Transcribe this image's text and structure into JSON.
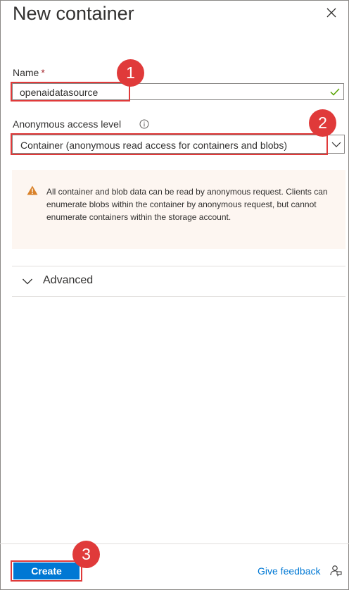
{
  "panel": {
    "title": "New container"
  },
  "name_field": {
    "label": "Name",
    "required_mark": "*",
    "value": "openaidatasource",
    "valid": true
  },
  "access_level": {
    "label": "Anonymous access level",
    "selected": "Container (anonymous read access for containers and blobs)"
  },
  "warning": {
    "text": "All container and blob data can be read by anonymous request. Clients can enumerate blobs within the container by anonymous request, but cannot enumerate containers within the storage account."
  },
  "advanced": {
    "label": "Advanced"
  },
  "footer": {
    "create_label": "Create",
    "feedback_label": "Give feedback"
  },
  "annotations": [
    "1",
    "2",
    "3"
  ],
  "colors": {
    "accent": "#0078d4",
    "annotation": "#e03a3a",
    "valid": "#57a300",
    "warning": "#d83b01"
  }
}
